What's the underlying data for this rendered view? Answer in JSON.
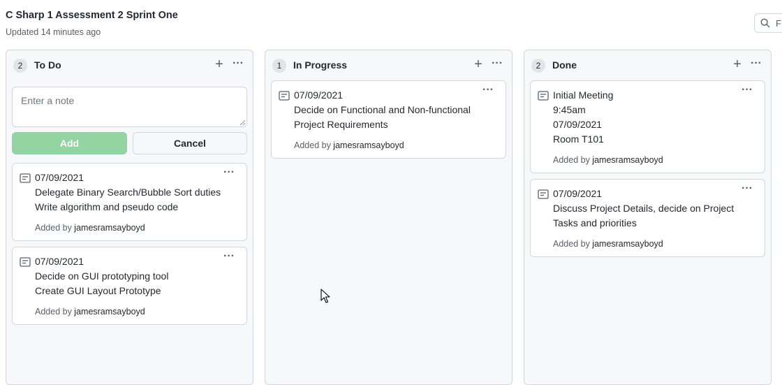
{
  "header": {
    "title": "C Sharp 1 Assessment 2 Sprint One",
    "updated": "Updated 14 minutes ago",
    "search_value": "F"
  },
  "columns": [
    {
      "name": "To Do",
      "count": "2",
      "add_icon": "+",
      "menu_icon": "···",
      "note_placeholder": "Enter a note",
      "add_label": "Add",
      "cancel_label": "Cancel",
      "cards": [
        {
          "lines": [
            "07/09/2021",
            "Delegate Binary Search/Bubble Sort duties",
            "Write algorithm and pseudo code"
          ],
          "added_by_prefix": "Added by ",
          "added_by_user": "jamesramsayboyd"
        },
        {
          "lines": [
            "07/09/2021",
            "Decide on GUI prototyping tool",
            "Create GUI Layout Prototype"
          ],
          "added_by_prefix": "Added by ",
          "added_by_user": "jamesramsayboyd"
        }
      ]
    },
    {
      "name": "In Progress",
      "count": "1",
      "add_icon": "+",
      "menu_icon": "···",
      "cards": [
        {
          "lines": [
            "07/09/2021",
            "Decide on Functional and Non-functional",
            "Project Requirements"
          ],
          "added_by_prefix": "Added by ",
          "added_by_user": "jamesramsayboyd"
        }
      ]
    },
    {
      "name": "Done",
      "count": "2",
      "add_icon": "+",
      "menu_icon": "···",
      "cards": [
        {
          "lines": [
            "Initial Meeting",
            "9:45am",
            "07/09/2021",
            "Room T101"
          ],
          "added_by_prefix": "Added by ",
          "added_by_user": "jamesramsayboyd"
        },
        {
          "lines": [
            "07/09/2021",
            "Discuss Project Details, decide on Project",
            "Tasks and priorities"
          ],
          "added_by_prefix": "Added by ",
          "added_by_user": "jamesramsayboyd"
        }
      ]
    }
  ],
  "card_menu_icon": "···",
  "icons": {
    "search": "search-icon",
    "note": "note-icon",
    "cursor": "mouse-pointer-icon"
  }
}
